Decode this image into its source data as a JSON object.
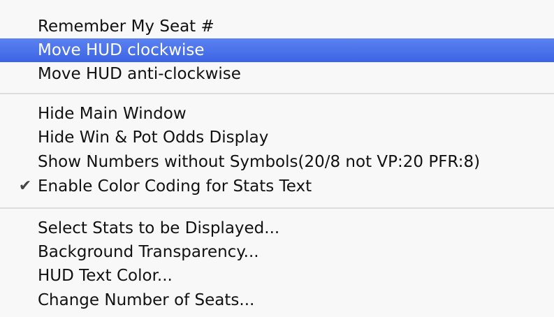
{
  "menu": {
    "items": [
      {
        "label": "Remember My Seat #"
      },
      {
        "label": "Move HUD clockwise",
        "highlighted": true
      },
      {
        "label": "Move HUD anti-clockwise"
      },
      {
        "label": "Hide Main Window"
      },
      {
        "label": "Hide Win & Pot Odds Display"
      },
      {
        "label": "Show Numbers without Symbols(20/8 not VP:20 PFR:8)"
      },
      {
        "label": "Enable Color Coding for Stats Text",
        "checked": true,
        "check_glyph": "✔"
      },
      {
        "label": "Select Stats to be Displayed..."
      },
      {
        "label": "Background Transparency..."
      },
      {
        "label": "HUD Text Color..."
      },
      {
        "label": "Change Number of Seats..."
      }
    ],
    "highlight_color": "#4a74ea"
  }
}
